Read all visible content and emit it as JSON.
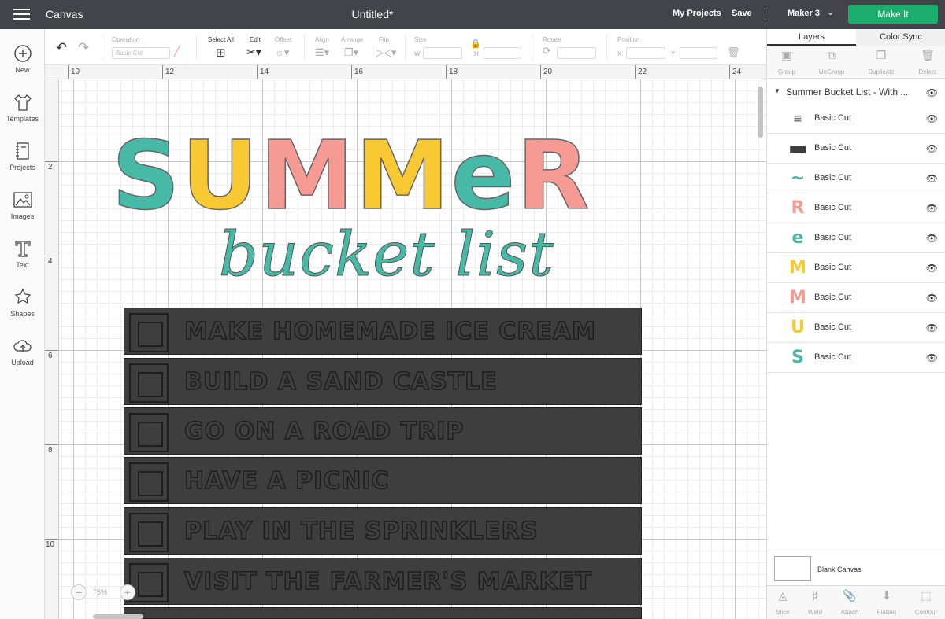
{
  "topbar": {
    "app_title": "Canvas",
    "doc_title": "Untitled*",
    "my_projects": "My Projects",
    "save": "Save",
    "machine": "Maker 3",
    "make_it": "Make It",
    "make_it_color": "#1cae6d"
  },
  "sidebar": {
    "items": [
      {
        "label": "New",
        "icon": "plus-circle-icon"
      },
      {
        "label": "Templates",
        "icon": "shirt-icon"
      },
      {
        "label": "Projects",
        "icon": "notebook-icon"
      },
      {
        "label": "Images",
        "icon": "image-icon"
      },
      {
        "label": "Text",
        "icon": "text-icon"
      },
      {
        "label": "Shapes",
        "icon": "shapes-icon"
      },
      {
        "label": "Upload",
        "icon": "cloud-upload-icon"
      }
    ]
  },
  "toolbar": {
    "operation_label": "Operation",
    "operation_value": "Basic Cut",
    "select_all": "Select All",
    "edit": "Edit",
    "offset": "Offset",
    "align": "Align",
    "arrange": "Arrange",
    "flip": "Flip",
    "size": "Size",
    "w": "W",
    "h": "H",
    "rotate": "Rotate",
    "position": "Position",
    "x": "X",
    "y": "Y"
  },
  "ruler": {
    "h_numbers": [
      "10",
      "12",
      "14",
      "16",
      "18",
      "20",
      "22",
      "24"
    ],
    "v_numbers": [
      "2",
      "4",
      "6",
      "8",
      "10"
    ]
  },
  "design": {
    "title_letters": [
      {
        "char": "S",
        "color": "#47b9a7"
      },
      {
        "char": "U",
        "color": "#f9c933"
      },
      {
        "char": "M",
        "color": "#f59b94"
      },
      {
        "char": "M",
        "color": "#f9c933"
      },
      {
        "char": "e",
        "color": "#47b9a7"
      },
      {
        "char": "R",
        "color": "#f59b94"
      }
    ],
    "subtitle": "bucket list",
    "items": [
      "Make homemade ice cream",
      "Build a sand castle",
      "Go on a road trip",
      "Have a picnic",
      "Play in the sprinklers",
      "Visit the farmer's market"
    ]
  },
  "zoom": {
    "minus": "−",
    "value": "75%",
    "plus": "+"
  },
  "panel": {
    "tabs": [
      "Layers",
      "Color Sync"
    ],
    "actions": [
      "Group",
      "UnGroup",
      "Duplicate",
      "Delete"
    ],
    "group_name": "Summer Bucket List - With ...",
    "layers": [
      {
        "label": "Basic Cut",
        "thumb": "≡",
        "color": "#777"
      },
      {
        "label": "Basic Cut",
        "thumb": "▬",
        "color": "#3e3e3f"
      },
      {
        "label": "Basic Cut",
        "thumb": "~",
        "color": "#47b9a7"
      },
      {
        "label": "Basic Cut",
        "thumb": "R",
        "color": "#f59b94"
      },
      {
        "label": "Basic Cut",
        "thumb": "e",
        "color": "#47b9a7"
      },
      {
        "label": "Basic Cut",
        "thumb": "M",
        "color": "#f9c933"
      },
      {
        "label": "Basic Cut",
        "thumb": "M",
        "color": "#f59b94"
      },
      {
        "label": "Basic Cut",
        "thumb": "U",
        "color": "#f9c933"
      },
      {
        "label": "Basic Cut",
        "thumb": "S",
        "color": "#47b9a7"
      }
    ],
    "blank_canvas": "Blank Canvas",
    "bottom_actions": [
      "Slice",
      "Weld",
      "Attach",
      "Flatten",
      "Contour"
    ]
  }
}
